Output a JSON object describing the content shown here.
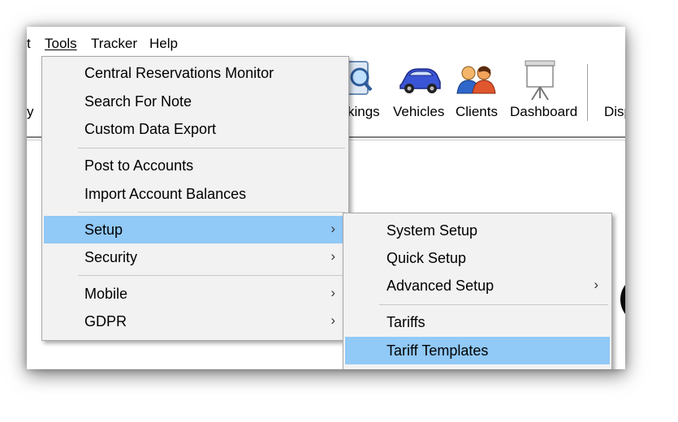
{
  "menubar": {
    "items": [
      {
        "label": "t"
      },
      {
        "label": "Tools"
      },
      {
        "label": "Tracker"
      },
      {
        "label": "Help"
      }
    ]
  },
  "toolbar": {
    "left_partial": "y",
    "buttons": [
      {
        "label": "kings",
        "icon": "magnifier-icon"
      },
      {
        "label": "Vehicles",
        "icon": "car-icon"
      },
      {
        "label": "Clients",
        "icon": "people-icon"
      },
      {
        "label": "Dashboard",
        "icon": "presentation-board-icon"
      },
      {
        "label": "Disp"
      }
    ]
  },
  "tools_menu": {
    "items": [
      {
        "label": "Central Reservations Monitor"
      },
      {
        "label": "Search For Note"
      },
      {
        "label": "Custom Data Export"
      },
      {
        "label": "Post to Accounts"
      },
      {
        "label": "Import Account Balances"
      },
      {
        "label": "Setup",
        "submenu": true,
        "highlighted": true
      },
      {
        "label": "Security",
        "submenu": true
      },
      {
        "label": "Mobile",
        "submenu": true
      },
      {
        "label": "GDPR",
        "submenu": true
      }
    ],
    "arrow": "›"
  },
  "setup_submenu": {
    "items": [
      {
        "label": "System Setup"
      },
      {
        "label": "Quick Setup"
      },
      {
        "label": "Advanced Setup",
        "submenu": true
      },
      {
        "label": "Tariffs"
      },
      {
        "label": "Tariff Templates",
        "highlighted": true
      }
    ]
  },
  "colors": {
    "highlight": "#91c9f7",
    "menu_bg": "#f2f2f2",
    "car_blue": "#3a55d6"
  }
}
